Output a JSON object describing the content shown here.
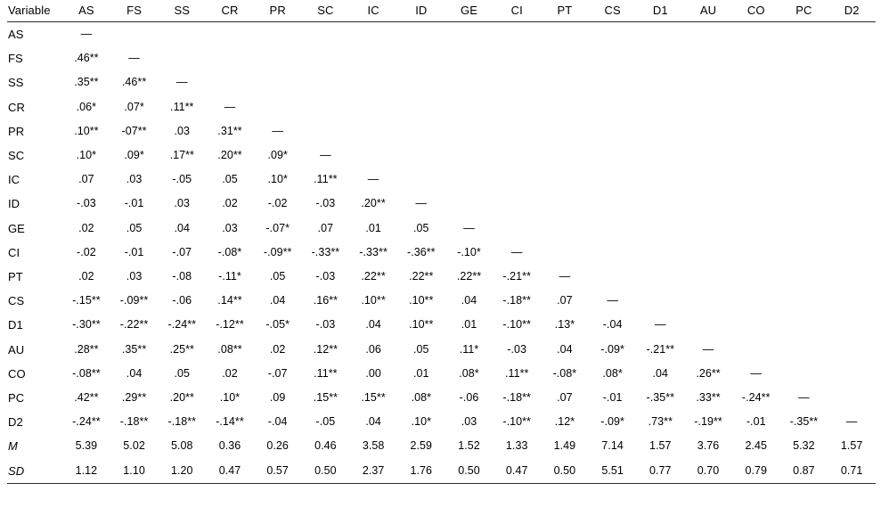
{
  "table": {
    "variable_header": "Variable",
    "columns": [
      "AS",
      "FS",
      "SS",
      "CR",
      "PR",
      "SC",
      "IC",
      "ID",
      "GE",
      "CI",
      "PT",
      "CS",
      "D1",
      "AU",
      "CO",
      "PC",
      "D2"
    ],
    "diagonal_symbol": "—",
    "rows": [
      {
        "label": "AS",
        "values": [
          "—"
        ]
      },
      {
        "label": "FS",
        "values": [
          ".46**",
          "—"
        ]
      },
      {
        "label": "SS",
        "values": [
          ".35**",
          ".46**",
          "—"
        ]
      },
      {
        "label": "CR",
        "values": [
          ".06*",
          ".07*",
          ".11**",
          "—"
        ]
      },
      {
        "label": "PR",
        "values": [
          ".10**",
          "-07**",
          ".03",
          ".31**",
          "—"
        ]
      },
      {
        "label": "SC",
        "values": [
          ".10*",
          ".09*",
          ".17**",
          ".20**",
          ".09*",
          "—"
        ]
      },
      {
        "label": "IC",
        "values": [
          ".07",
          ".03",
          "-.05",
          ".05",
          ".10*",
          ".11**",
          "—"
        ]
      },
      {
        "label": "ID",
        "values": [
          "-.03",
          "-.01",
          ".03",
          ".02",
          "-.02",
          "-.03",
          ".20**",
          "—"
        ]
      },
      {
        "label": "GE",
        "values": [
          ".02",
          ".05",
          ".04",
          ".03",
          "-.07*",
          ".07",
          ".01",
          ".05",
          "—"
        ]
      },
      {
        "label": "CI",
        "values": [
          "-.02",
          "-.01",
          "-.07",
          "-.08*",
          "-.09**",
          "-.33**",
          "-.33**",
          "-.36**",
          "-.10*",
          "—"
        ]
      },
      {
        "label": "PT",
        "values": [
          ".02",
          ".03",
          "-.08",
          "-.11*",
          ".05",
          "-.03",
          ".22**",
          ".22**",
          ".22**",
          "-.21**",
          "—"
        ]
      },
      {
        "label": "CS",
        "values": [
          "-.15**",
          "-.09**",
          "-.06",
          ".14**",
          ".04",
          ".16**",
          ".10**",
          ".10**",
          ".04",
          "-.18**",
          ".07",
          "—"
        ]
      },
      {
        "label": "D1",
        "values": [
          "-.30**",
          "-.22**",
          "-.24**",
          "-.12**",
          "-.05*",
          "-.03",
          ".04",
          ".10**",
          ".01",
          "-.10**",
          ".13*",
          "-.04",
          "—"
        ]
      },
      {
        "label": "AU",
        "values": [
          ".28**",
          ".35**",
          ".25**",
          ".08**",
          ".02",
          ".12**",
          ".06",
          ".05",
          ".11*",
          "-.03",
          ".04",
          "-.09*",
          "-.21**",
          "—"
        ]
      },
      {
        "label": "CO",
        "values": [
          "-.08**",
          ".04",
          ".05",
          ".02",
          "-.07",
          ".11**",
          ".00",
          ".01",
          ".08*",
          ".11**",
          "-.08*",
          ".08*",
          ".04",
          ".26**",
          "—"
        ]
      },
      {
        "label": "PC",
        "values": [
          ".42**",
          ".29**",
          ".20**",
          ".10*",
          ".09",
          ".15**",
          ".15**",
          ".08*",
          "-.06",
          "-.18**",
          ".07",
          "-.01",
          "-.35**",
          ".33**",
          "-.24**",
          "—"
        ]
      },
      {
        "label": "D2",
        "values": [
          "-.24**",
          "-.18**",
          "-.18**",
          "-.14**",
          "-.04",
          "-.05",
          ".04",
          ".10*",
          ".03",
          "-.10**",
          ".12*",
          "-.09*",
          ".73**",
          "-.19**",
          "-.01",
          "-.35**",
          "—"
        ]
      }
    ],
    "stats": [
      {
        "label": "M",
        "values": [
          "5.39",
          "5.02",
          "5.08",
          "0.36",
          "0.26",
          "0.46",
          "3.58",
          "2.59",
          "1.52",
          "1.33",
          "1.49",
          "7.14",
          "1.57",
          "3.76",
          "2.45",
          "5.32",
          "1.57"
        ]
      },
      {
        "label": "SD",
        "values": [
          "1.12",
          "1.10",
          "1.20",
          "0.47",
          "0.57",
          "0.50",
          "2.37",
          "1.76",
          "0.50",
          "0.47",
          "0.50",
          "5.51",
          "0.77",
          "0.70",
          "0.79",
          "0.87",
          "0.71"
        ]
      }
    ]
  }
}
